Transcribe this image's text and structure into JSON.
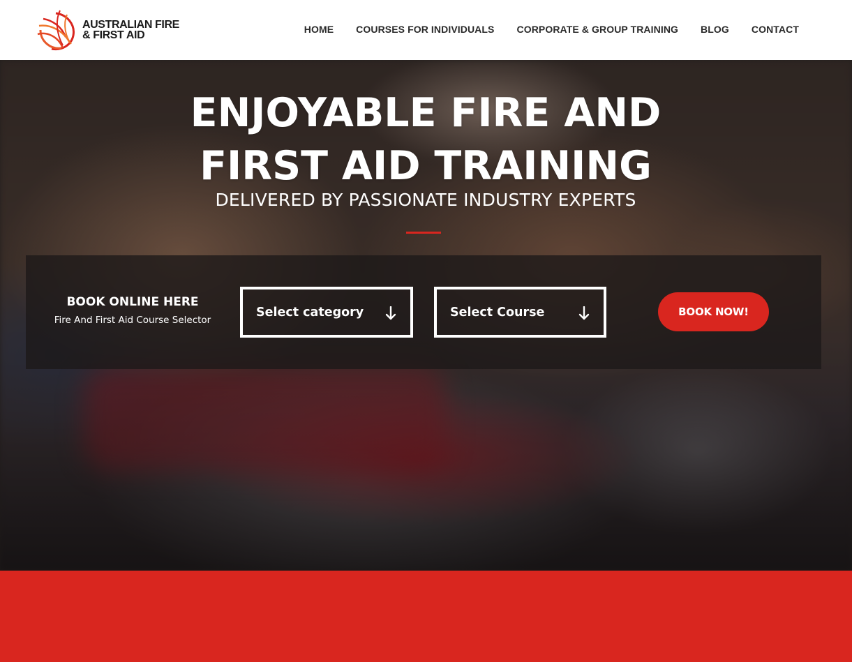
{
  "brand": {
    "name_line1": "AUSTRALIAN FIRE",
    "name_line2": "& FIRST AID",
    "logo_icon": "globe-flame-icon",
    "accent_color": "#d9261f"
  },
  "nav": {
    "items": [
      {
        "label": "HOME"
      },
      {
        "label": "COURSES FOR INDIVIDUALS"
      },
      {
        "label": "CORPORATE & GROUP TRAINING"
      },
      {
        "label": "BLOG"
      },
      {
        "label": "CONTACT"
      }
    ]
  },
  "hero": {
    "title_line1": "ENJOYABLE FIRE AND",
    "title_line2": "FIRST AID TRAINING",
    "subtitle": "DELIVERED BY PASSIONATE INDUSTRY EXPERTS"
  },
  "booking": {
    "heading": "BOOK ONLINE HERE",
    "subheading": "Fire And First Aid Course Selector",
    "category_select": {
      "selected": "Select category",
      "icon": "arrow-down-icon"
    },
    "course_select": {
      "selected": "Select Course",
      "icon": "arrow-down-icon"
    },
    "book_button": "BOOK NOW!"
  }
}
